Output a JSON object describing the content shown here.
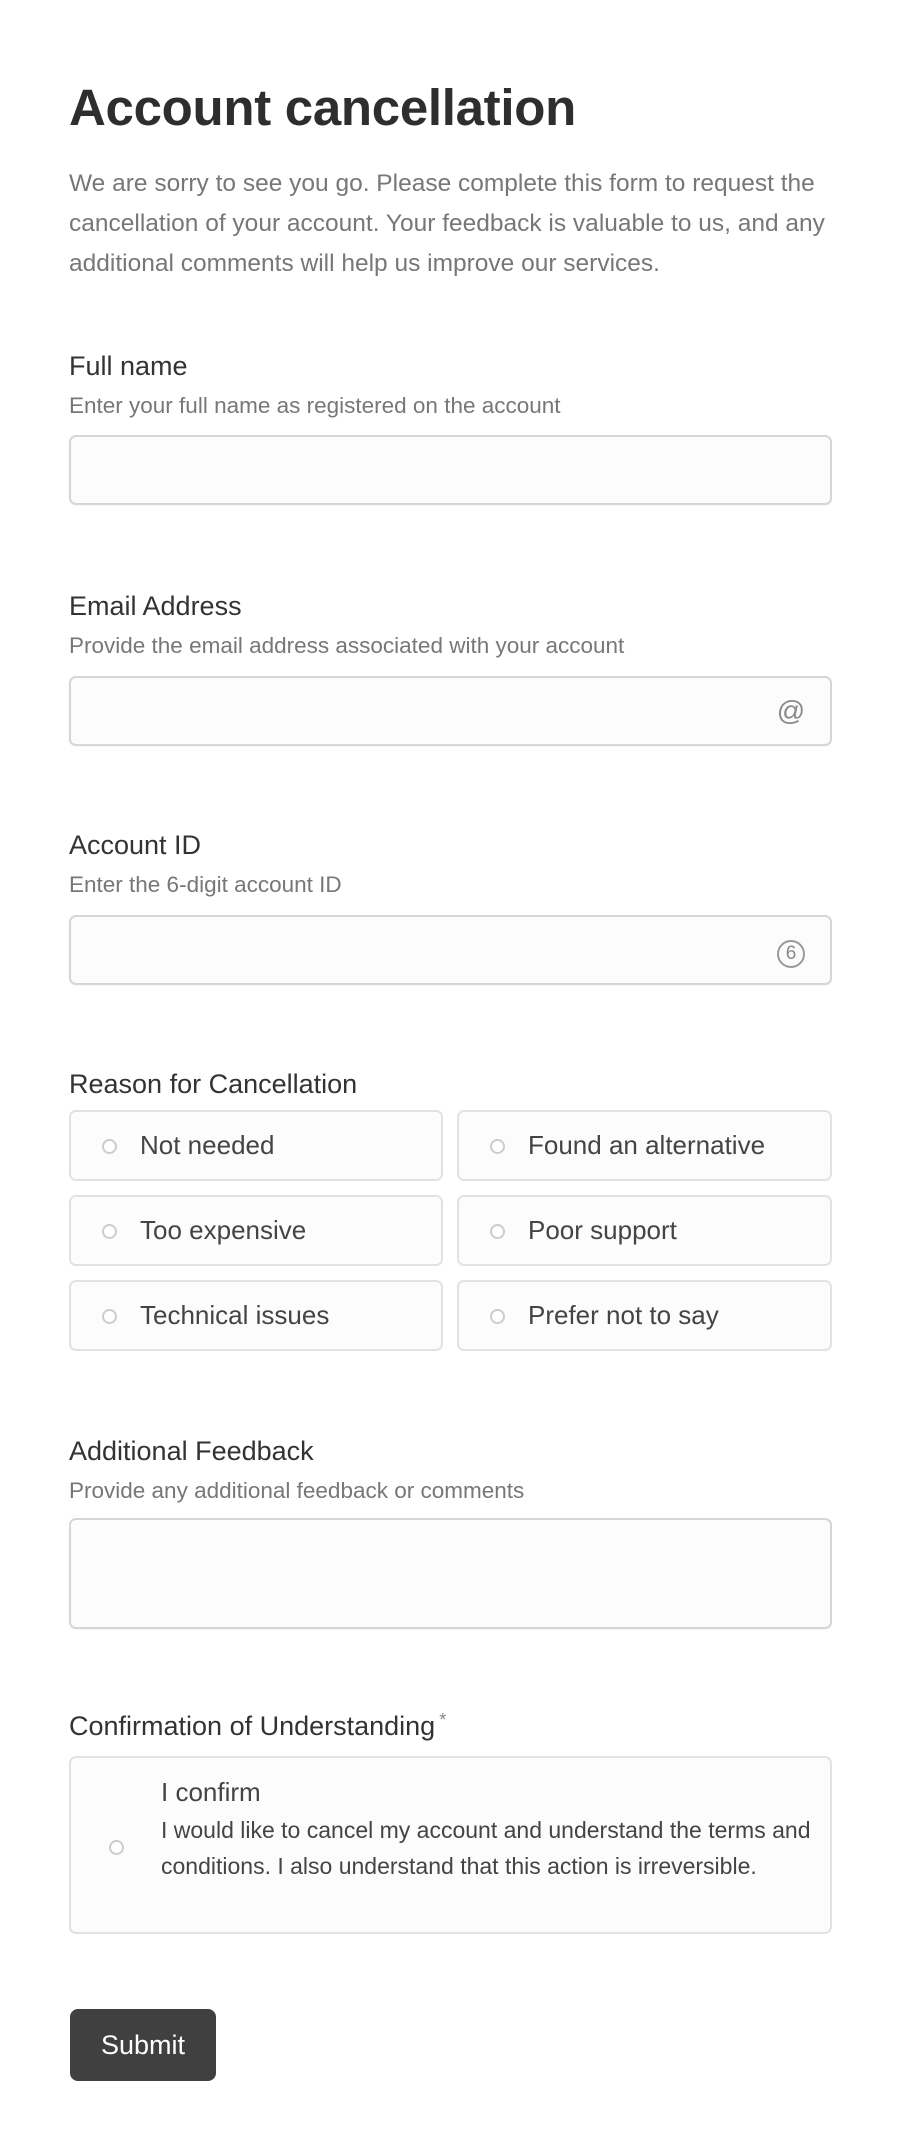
{
  "header": {
    "title": "Account cancellation",
    "description": "We are sorry to see you go. Please complete this form to request the cancellation of your account. Your feedback is valuable to us, and any additional comments will help us improve our services."
  },
  "fields": {
    "full_name": {
      "label": "Full name",
      "hint": "Enter your full name as registered on the account",
      "value": "",
      "placeholder": ""
    },
    "email": {
      "label": "Email Address",
      "hint": "Provide the email address associated with your account",
      "value": "",
      "placeholder": "",
      "icon": "at-sign-icon",
      "icon_glyph": "@"
    },
    "account_id": {
      "label": "Account ID",
      "hint": "Enter the 6-digit account ID",
      "value": "",
      "placeholder": "",
      "icon": "circled-six-icon",
      "icon_glyph": "6"
    },
    "reason": {
      "label": "Reason for Cancellation",
      "options": [
        {
          "label": "Not needed",
          "selected": false
        },
        {
          "label": "Found an alternative",
          "selected": false
        },
        {
          "label": "Too expensive",
          "selected": false
        },
        {
          "label": "Poor support",
          "selected": false
        },
        {
          "label": "Technical issues",
          "selected": false
        },
        {
          "label": "Prefer not to say",
          "selected": false
        }
      ]
    },
    "feedback": {
      "label": "Additional Feedback",
      "hint": "Provide any additional feedback or comments",
      "value": "",
      "placeholder": ""
    },
    "confirmation": {
      "label": "Confirmation of Understanding",
      "required_marker": "*",
      "option_title": "I confirm",
      "option_text": "I would like to cancel my account and understand the terms and conditions. I also understand that this action is irreversible.",
      "selected": false
    }
  },
  "actions": {
    "submit_label": "Submit"
  },
  "colors": {
    "button_bg": "#404040",
    "text_primary": "#333333",
    "text_secondary": "#777777",
    "field_border": "#d6d6d6",
    "field_bg": "#fcfcfc"
  }
}
